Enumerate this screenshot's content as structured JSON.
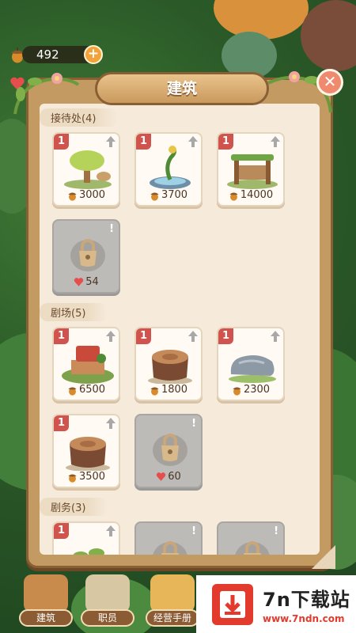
{
  "hud": {
    "acorn_count": "492",
    "plus_label": "+"
  },
  "panel": {
    "title": "建筑",
    "close_label": "✕"
  },
  "sections": [
    {
      "header": "接待处(4)",
      "cards": [
        {
          "level": "1",
          "locked": false,
          "cost": "3000",
          "currency": "acorn",
          "art": "mushroom-tree"
        },
        {
          "level": "1",
          "locked": false,
          "cost": "3700",
          "currency": "acorn",
          "art": "vine-fountain"
        },
        {
          "level": "1",
          "locked": false,
          "cost": "14000",
          "currency": "acorn",
          "art": "wooden-gate"
        },
        {
          "level": "",
          "locked": true,
          "cost": "54",
          "currency": "heart",
          "art": "lock"
        }
      ]
    },
    {
      "header": "剧场(5)",
      "cards": [
        {
          "level": "1",
          "locked": false,
          "cost": "6500",
          "currency": "acorn",
          "art": "stage"
        },
        {
          "level": "1",
          "locked": false,
          "cost": "1800",
          "currency": "acorn",
          "art": "tree-stump"
        },
        {
          "level": "1",
          "locked": false,
          "cost": "2300",
          "currency": "acorn",
          "art": "stone"
        },
        {
          "level": "1",
          "locked": false,
          "cost": "3500",
          "currency": "acorn",
          "art": "tree-stump"
        },
        {
          "level": "",
          "locked": true,
          "cost": "60",
          "currency": "heart",
          "art": "lock"
        }
      ]
    },
    {
      "header": "剧务(3)",
      "cards": [
        {
          "level": "1",
          "locked": false,
          "cost": "",
          "currency": "",
          "art": "sprout"
        },
        {
          "level": "",
          "locked": true,
          "cost": "",
          "currency": "",
          "art": "lock"
        },
        {
          "level": "",
          "locked": true,
          "cost": "",
          "currency": "",
          "art": "lock"
        }
      ]
    }
  ],
  "bottom_nav": [
    {
      "label": "建筑"
    },
    {
      "label": "职员"
    },
    {
      "label": "经营手册"
    }
  ],
  "watermark": {
    "title": "7n下载站",
    "url": "www.7ndn.com"
  },
  "colors": {
    "panel_frame": "#c49a63",
    "panel_paper": "#f6eadb",
    "level_badge": "#d0534e",
    "close_button": "#f08a6e",
    "heart": "#e64d4d",
    "acorn": "#d98a2b"
  }
}
